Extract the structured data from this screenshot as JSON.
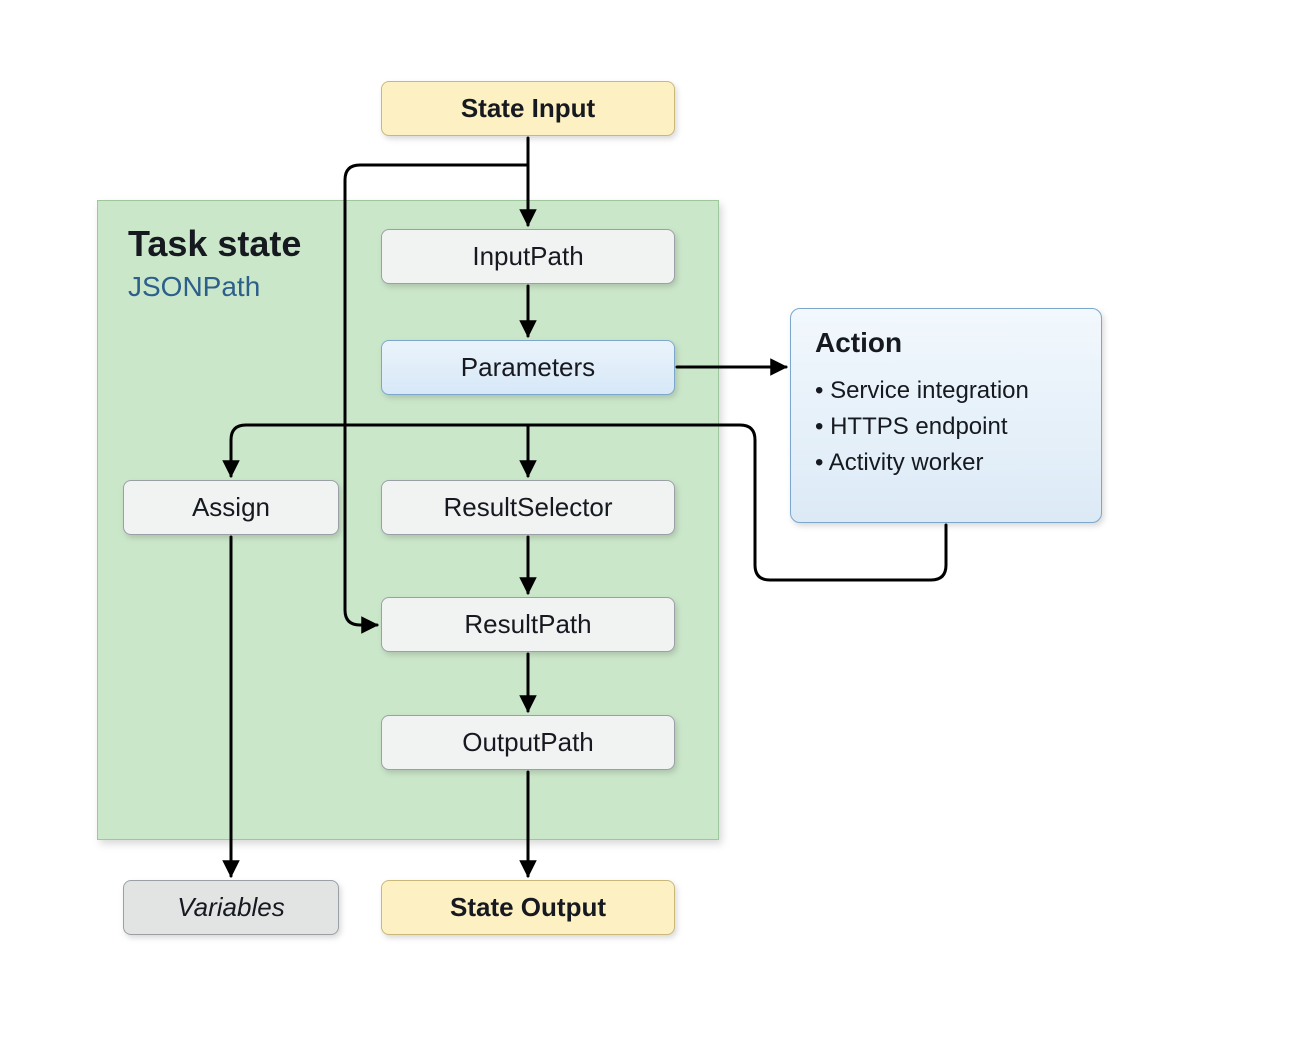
{
  "nodes": {
    "state_input": "State Input",
    "input_path": "InputPath",
    "parameters": "Parameters",
    "assign": "Assign",
    "result_selector": "ResultSelector",
    "result_path": "ResultPath",
    "output_path": "OutputPath",
    "variables": "Variables",
    "state_output": "State Output"
  },
  "container": {
    "title": "Task state",
    "subtitle": "JSONPath"
  },
  "action": {
    "title": "Action",
    "items": [
      "Service integration",
      "HTTPS endpoint",
      "Activity worker"
    ]
  }
}
